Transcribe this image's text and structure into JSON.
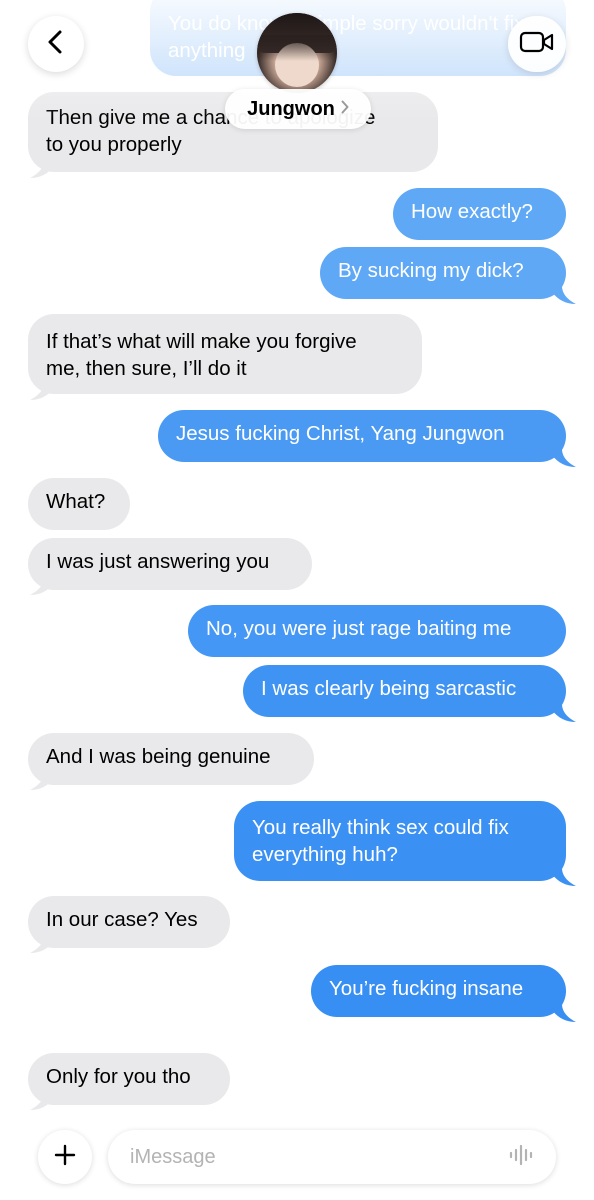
{
  "header": {
    "contact_name": "Jungwon"
  },
  "messages": [
    {
      "dir": "out",
      "text": "You do know a simple sorry wouldn't fix anything"
    },
    {
      "dir": "in",
      "text": "Then give me a chance to apologize\nto you properly"
    },
    {
      "dir": "out",
      "text": "How exactly?"
    },
    {
      "dir": "out",
      "text": "By sucking my dick?"
    },
    {
      "dir": "in",
      "text": "If that’s what will make you forgive\nme, then sure, I’ll do it"
    },
    {
      "dir": "out",
      "text": "Jesus fucking Christ, Yang Jungwon"
    },
    {
      "dir": "in",
      "text": "What?"
    },
    {
      "dir": "in",
      "text": "I was just answering you"
    },
    {
      "dir": "out",
      "text": "No, you were just rage baiting me"
    },
    {
      "dir": "out",
      "text": "I was clearly being sarcastic"
    },
    {
      "dir": "in",
      "text": "And I was being genuine"
    },
    {
      "dir": "out",
      "text": "You really think sex could fix\neverything huh?"
    },
    {
      "dir": "in",
      "text": "In our case? Yes"
    },
    {
      "dir": "out",
      "text": "You’re fucking insane"
    },
    {
      "dir": "in",
      "text": "Only for you tho"
    }
  ],
  "composer": {
    "placeholder": "iMessage"
  },
  "colors": {
    "outgoing": "#3b91f3",
    "incoming": "#e9e9eb",
    "placeholder": "#b3b3b3"
  },
  "icons": {
    "back": "chevron-left-icon",
    "video": "video-camera-icon",
    "plus": "plus-icon",
    "audio": "waveform-icon"
  }
}
